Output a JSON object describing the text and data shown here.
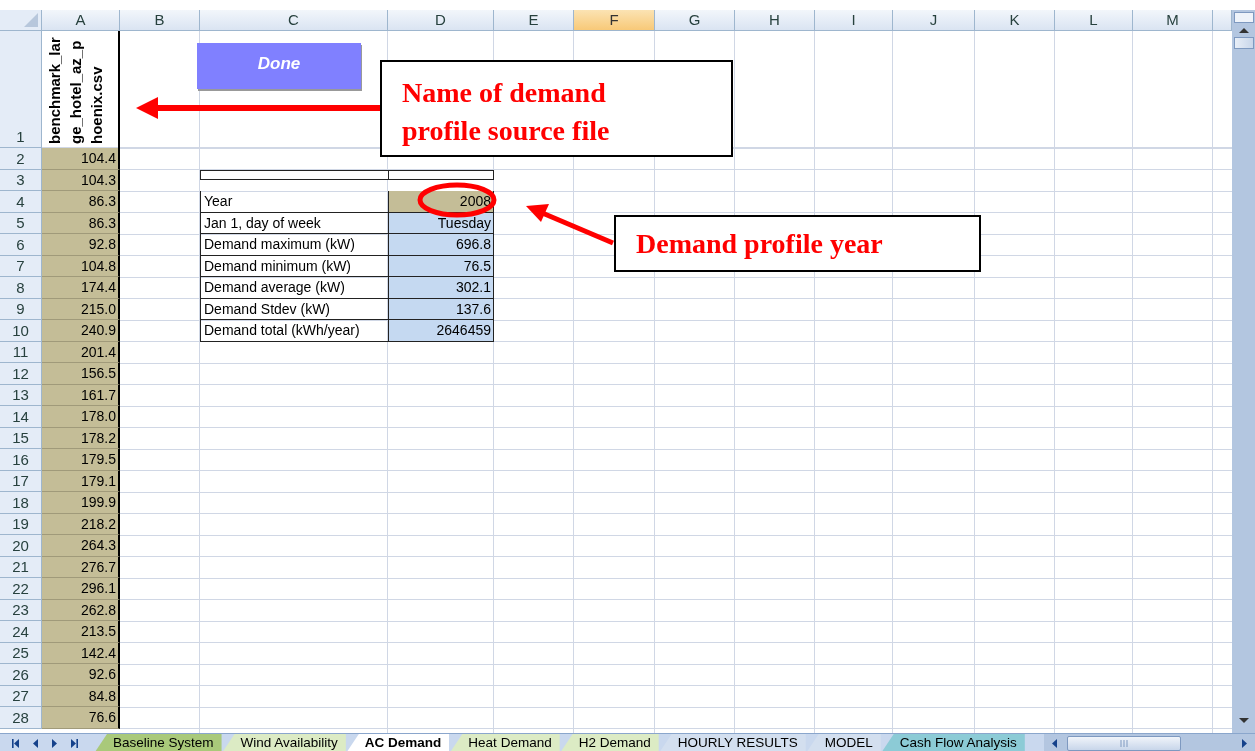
{
  "column_headers": [
    {
      "label": "A",
      "selected": false
    },
    {
      "label": "B",
      "selected": false
    },
    {
      "label": "C",
      "selected": false
    },
    {
      "label": "D",
      "selected": false
    },
    {
      "label": "E",
      "selected": false
    },
    {
      "label": "F",
      "selected": true
    },
    {
      "label": "G",
      "selected": false
    },
    {
      "label": "H",
      "selected": false
    },
    {
      "label": "I",
      "selected": false
    },
    {
      "label": "J",
      "selected": false
    },
    {
      "label": "K",
      "selected": false
    },
    {
      "label": "L",
      "selected": false
    },
    {
      "label": "M",
      "selected": false
    }
  ],
  "row_numbers": [
    "1",
    "2",
    "3",
    "4",
    "5",
    "6",
    "7",
    "8",
    "9",
    "10",
    "11",
    "12",
    "13",
    "14",
    "15",
    "16",
    "17",
    "18",
    "19",
    "20",
    "21",
    "22",
    "23",
    "24",
    "25",
    "26",
    "27",
    "28"
  ],
  "column_a": {
    "header": "benchmark_large_hotel_az_phoenix.csv",
    "values": [
      "104.4",
      "104.3",
      "86.3",
      "86.3",
      "92.8",
      "104.8",
      "174.4",
      "215.0",
      "240.9",
      "201.4",
      "156.5",
      "161.7",
      "178.0",
      "178.2",
      "179.5",
      "179.1",
      "199.9",
      "218.2",
      "264.3",
      "276.7",
      "296.1",
      "262.8",
      "213.5",
      "142.4",
      "92.6",
      "84.8",
      "76.6"
    ]
  },
  "done_button": "Done",
  "summary_table": [
    {
      "label": "Year",
      "value": "2008",
      "kind": "input"
    },
    {
      "label": "Jan 1, day of week",
      "value": "Tuesday",
      "kind": "computed"
    },
    {
      "label": "Demand maximum (kW)",
      "value": "696.8",
      "kind": "computed"
    },
    {
      "label": "Demand minimum (kW)",
      "value": "76.5",
      "kind": "computed"
    },
    {
      "label": "Demand average (kW)",
      "value": "302.1",
      "kind": "computed"
    },
    {
      "label": "Demand Stdev (kW)",
      "value": "137.6",
      "kind": "computed"
    },
    {
      "label": "Demand total (kWh/year)",
      "value": "2646459",
      "kind": "computed"
    }
  ],
  "callouts": [
    {
      "text": "Name of demand profile source file"
    },
    {
      "text": "Demand profile year"
    }
  ],
  "sheet_tabs": [
    {
      "label": "Baseline System",
      "selected": false,
      "color": "#a9c97a"
    },
    {
      "label": "Wind Availability",
      "selected": false,
      "color": "#dcebc4"
    },
    {
      "label": "AC Demand",
      "selected": true,
      "color": "#ffffff"
    },
    {
      "label": "Heat Demand",
      "selected": false,
      "color": "#dcebc4"
    },
    {
      "label": "H2 Demand",
      "selected": false,
      "color": "#dcebc4"
    },
    {
      "label": "HOURLY RESULTS",
      "selected": false,
      "color": "#d3dfef"
    },
    {
      "label": "MODEL",
      "selected": false,
      "color": "#d3dfef"
    },
    {
      "label": "Cash Flow Analysis",
      "selected": false,
      "color": "#8ccbd6"
    }
  ]
}
